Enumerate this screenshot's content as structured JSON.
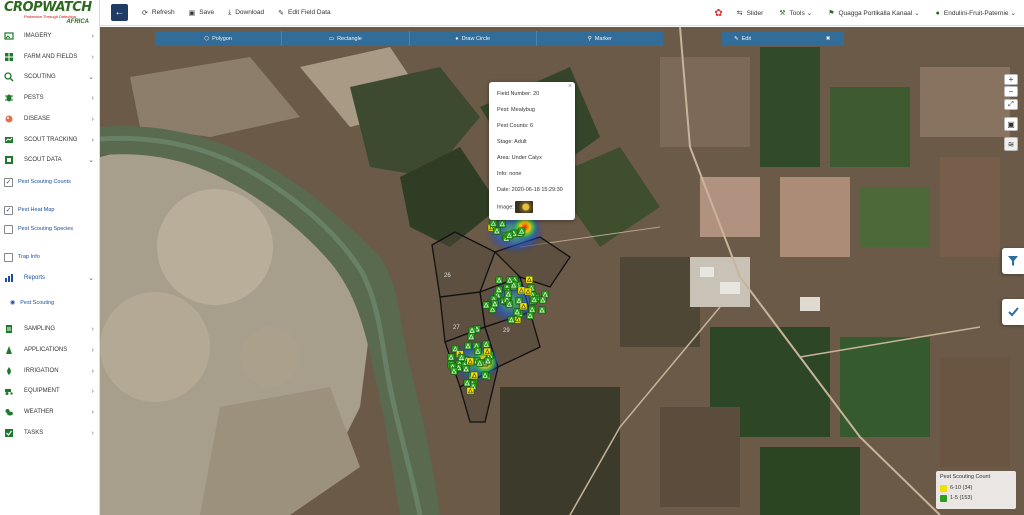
{
  "app": {
    "brand": "CROPWATCH",
    "tagline": "Protection Through Detection",
    "region": "AFRICA"
  },
  "toolbar": {
    "refresh": "Refresh",
    "save": "Save",
    "download": "Download",
    "edit_field_data": "Edit Field Data",
    "slider": "Slider",
    "tools": "Tools",
    "farm": "Quagga Portikalla Kanaal",
    "user": "Endulini-Fruit-Paternie"
  },
  "sidebar": {
    "items": [
      {
        "label": "Imagery",
        "icon": "imagery-icon"
      },
      {
        "label": "Farm and Fields",
        "icon": "farm-icon"
      },
      {
        "label": "Scouting",
        "icon": "scouting-icon"
      },
      {
        "label": "Pests",
        "icon": "pests-icon"
      },
      {
        "label": "Disease",
        "icon": "disease-icon"
      },
      {
        "label": "Scout Tracking",
        "icon": "scout-tracking-icon"
      },
      {
        "label": "Scout Data",
        "icon": "scout-data-icon"
      }
    ],
    "scout_data_sub": [
      {
        "label": "Pest Scouting Counts",
        "checked": true
      },
      {
        "label": "Pest Heat Map",
        "checked": true
      },
      {
        "label": "Pest Scouting Species",
        "checked": false
      },
      {
        "label": "Trap Info",
        "checked": false
      }
    ],
    "reports": {
      "label": "Reports",
      "sub": "Pest Scouting"
    },
    "items2": [
      {
        "label": "Sampling",
        "icon": "sampling-icon"
      },
      {
        "label": "Applications",
        "icon": "applications-icon"
      },
      {
        "label": "Irrigation",
        "icon": "irrigation-icon"
      },
      {
        "label": "Equipment",
        "icon": "equipment-icon"
      },
      {
        "label": "Weather",
        "icon": "weather-icon"
      },
      {
        "label": "Tasks",
        "icon": "tasks-icon"
      }
    ]
  },
  "drawbar": {
    "polygon": "Polygon",
    "rectangle": "Rectangle",
    "draw_circle": "Draw Circle",
    "marker": "Marker",
    "edit": "Edit",
    "delete": "✖"
  },
  "popup": {
    "field_number": "Field Number: 20",
    "pest": "Pest: Mealybug",
    "pest_counts": "Pest Counts: 6",
    "stage": "Stage: Adult",
    "area": "Area: Under Calyx",
    "info": "Info: none",
    "date": "Date: 2020-06-18 15:29:30",
    "image_label": "Image:"
  },
  "map": {
    "field_labels": [
      "26",
      "27",
      "28",
      "29"
    ]
  },
  "legend": {
    "title": "Pest Scouting Count",
    "rows": [
      {
        "label": "6-10 (34)",
        "color": "#f0e000"
      },
      {
        "label": "1-5 (153)",
        "color": "#2e9e1e"
      }
    ]
  },
  "colors": {
    "accent": "#2f6f9f",
    "back_button": "#1f3b63",
    "brand_green": "#2d6a1f"
  }
}
